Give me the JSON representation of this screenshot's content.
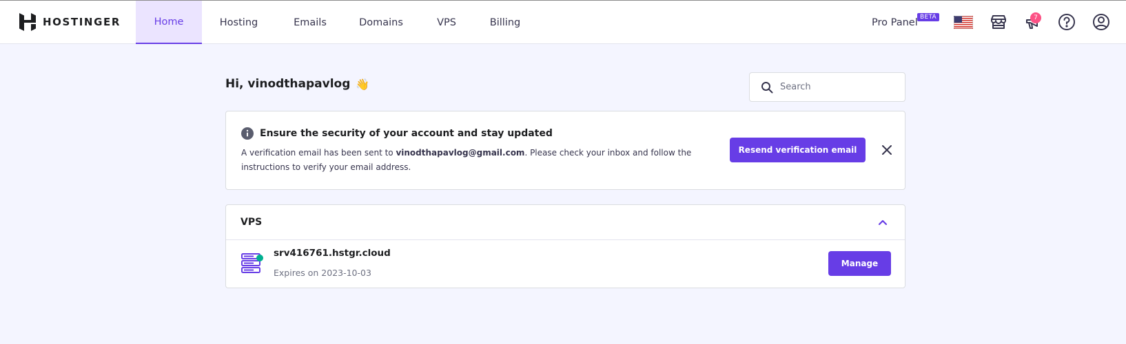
{
  "brand": {
    "name": "HOSTINGER"
  },
  "nav": [
    {
      "label": "Home",
      "active": true
    },
    {
      "label": "Hosting",
      "active": false
    },
    {
      "label": "Emails",
      "active": false
    },
    {
      "label": "Domains",
      "active": false
    },
    {
      "label": "VPS",
      "active": false
    },
    {
      "label": "Billing",
      "active": false
    }
  ],
  "topbar": {
    "pro_panel_label": "Pro Panel",
    "beta_label": "BETA",
    "notifications_count": "7",
    "icons": [
      "us-flag-icon",
      "store-icon",
      "megaphone-icon",
      "help-icon",
      "account-icon"
    ]
  },
  "greeting": {
    "text": "Hi, vinodthapavlog",
    "emoji": "👋"
  },
  "search": {
    "placeholder": "Search",
    "value": ""
  },
  "alert": {
    "title": "Ensure the security of your account and stay updated",
    "text_before": "A verification email has been sent to ",
    "email": "vinodthapavlog@gmail.com",
    "text_after": ". Please check your inbox and follow the instructions to verify your email address.",
    "button_label": "Resend verification email"
  },
  "vps": {
    "title": "VPS",
    "server_name": "srv416761.hstgr.cloud",
    "expires": "Expires on 2023-10-03",
    "manage_label": "Manage"
  },
  "colors": {
    "accent": "#673de6",
    "background": "#f4f5ff",
    "badge": "#fc5185",
    "status_dot": "#00b090"
  }
}
